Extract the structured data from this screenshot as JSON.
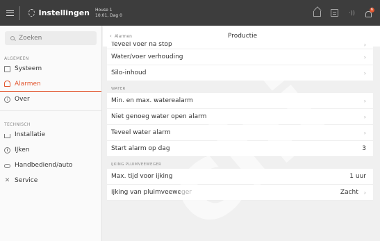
{
  "topbar": {
    "app_title": "Instellingen",
    "house_name": "House 1",
    "house_time": "10:01, Dag 0",
    "notification_count": "6"
  },
  "sidebar": {
    "search_placeholder": "Zoeken",
    "sections": [
      {
        "label": "ALGEMEEN",
        "items": [
          {
            "label": "Systeem",
            "icon": "box-icon"
          },
          {
            "label": "Alarmen",
            "icon": "bell-icon",
            "active": true
          },
          {
            "label": "Over",
            "icon": "info-icon"
          }
        ]
      },
      {
        "label": "TECHNISCH",
        "items": [
          {
            "label": "Installatie",
            "icon": "house-icon"
          },
          {
            "label": "IJken",
            "icon": "scale-icon"
          },
          {
            "label": "Handbediend/auto",
            "icon": "remote-icon"
          },
          {
            "label": "Service",
            "icon": "tools-icon"
          }
        ]
      }
    ]
  },
  "header": {
    "back_label": "Alarmen",
    "title": "Productie"
  },
  "rows_top": [
    {
      "label": "Teveel voer na stop"
    },
    {
      "label": "Water/voer verhouding"
    },
    {
      "label": "Silo-inhoud"
    }
  ],
  "group_water": "WATER",
  "rows_water": [
    {
      "label": "Min. en max. waterealarm"
    },
    {
      "label": "Niet genoeg water open alarm"
    },
    {
      "label": "Teveel water alarm"
    },
    {
      "label": "Start alarm op dag",
      "value": "3"
    }
  ],
  "group_weigher": "IJKING PLUIMVEEWEGER",
  "rows_weigher": [
    {
      "label": "Max. tijd voor ijking",
      "value": "1 uur"
    },
    {
      "label": "Ijking van pluimveeweger",
      "value": "Zacht"
    }
  ],
  "watermark": "chi",
  "colors": {
    "accent": "#e2562f",
    "topbar": "#3d3d3d"
  }
}
